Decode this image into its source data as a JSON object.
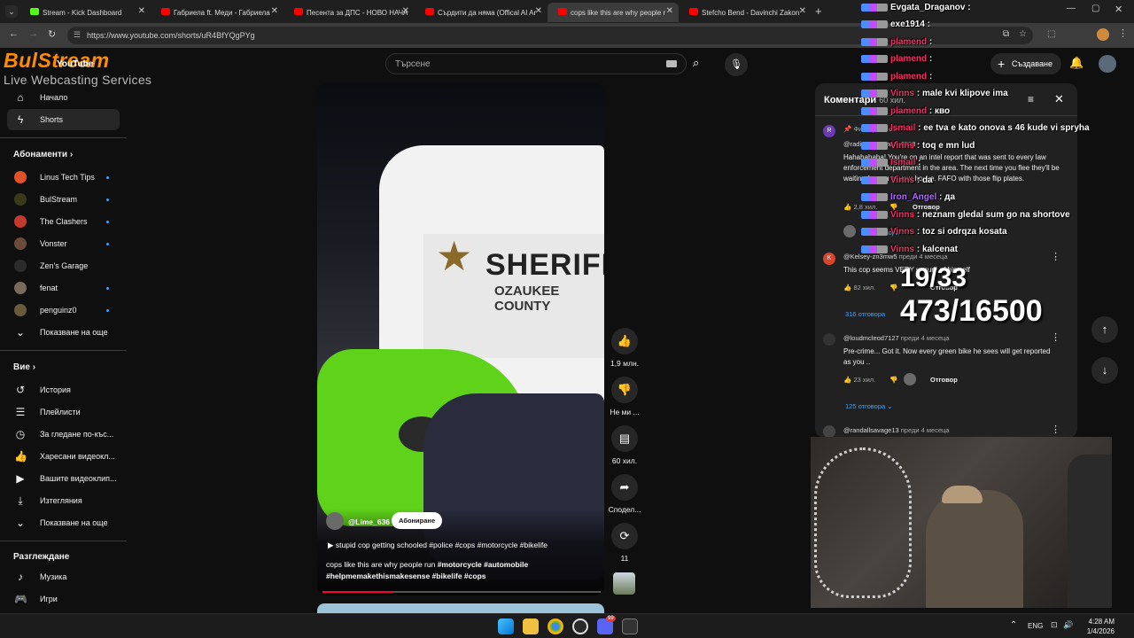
{
  "browser": {
    "tabs": [
      {
        "label": "Stream - Kick Dashboard",
        "favicon": "kick"
      },
      {
        "label": "Габриела ft. Меди - Габриела",
        "favicon": "youtube"
      },
      {
        "label": "Песента за ДПС - НОВО НАЧА",
        "favicon": "youtube"
      },
      {
        "label": "Сърдити да няма (Offical AI Ar",
        "favicon": "youtube"
      },
      {
        "label": "cops like this are why people r",
        "favicon": "youtube",
        "active": true
      },
      {
        "label": "Stefcho Bend - Davinchi Zakon",
        "favicon": "youtube"
      }
    ],
    "url": "https://www.youtube.com/shorts/uR4BfYQgPYg"
  },
  "overlay_logo": {
    "line1": "BulStream",
    "line2": "Live Webcasting Services",
    "yt_text": "YouTube"
  },
  "search": {
    "placeholder": "Търсене"
  },
  "header": {
    "create_label": "Създаване"
  },
  "sidebar": {
    "home": "Начало",
    "shorts": "Shorts",
    "subscriptions_title": "Абонаменти",
    "subscriptions": [
      {
        "label": "Linus Tech Tips",
        "color": "#e0512a"
      },
      {
        "label": "BulStream",
        "color": "#3a3a1a"
      },
      {
        "label": "The Clashers",
        "color": "#c43b2d"
      },
      {
        "label": "Vonster",
        "color": "#6b4a3a"
      },
      {
        "label": "Zen's Garage",
        "color": "#2b2b2b"
      },
      {
        "label": "fenat",
        "color": "#7a6a5a"
      },
      {
        "label": "penguinz0",
        "color": "#6a5a3a"
      }
    ],
    "show_more_1": "Показване на още",
    "you_title": "Вие",
    "you_items": [
      "История",
      "Плейлисти",
      "За гледане по-къс...",
      "Харесани видеокл...",
      "Вашите видеоклип...",
      "Изтегляния"
    ],
    "show_more_2": "Показване на още",
    "explore_title": "Разглеждане",
    "explore_items": [
      "Музика",
      "Игри"
    ]
  },
  "video": {
    "channel": "@Lime_636",
    "subscribe": "Абониране",
    "music_line": "stupid cop getting schooled #police #cops #motorcycle #bikelife",
    "title_line1_plain": "cops like this are why people run ",
    "title_line1_tags": "#motorcycle  #automobile",
    "title_line2": "#helpmemakethismakesense #bikelife  #cops",
    "sign_text": "SHERIFF",
    "county_text": "OZAUKEE COUNTY",
    "progress": 0.25
  },
  "actions": {
    "likes": "1,9 млн.",
    "dislike": "Не ми ...",
    "comments": "60 хил.",
    "share": "Сподел...",
    "remix": "11"
  },
  "comments_panel": {
    "title": "Коментари",
    "count": "60 хил.",
    "pinned_by": "Фиксирано от",
    "c1_user": "@radioreparemode8528",
    "c1_text": "Hahahahaha! You're on an intel report that was sent to every law enforcement department in the area. The next time you flee they'll be waiting for you at your house. FAFO with those flip plates.",
    "c1_likes": "2,8 хил.",
    "reply": "Отговор",
    "c1_replies": "23 отговора",
    "c2_user": "@Kelsey-zn3mw5",
    "c2_time": "преди 4 месеца",
    "c2_text": "This cop seems VERY unsure of himself",
    "c2_likes": "82 хил.",
    "c2_replies": "316 отговора",
    "c3_user": "@loudmcleod7127",
    "c3_time": "преди 4 месеца",
    "c3_text": "Pre-crime... Got it. Now every green bike he sees will get reported as you ..",
    "c3_likes": "23 хил.",
    "c3_replies": "125 отговора",
    "c4_user": "@randallsavage13",
    "c4_time": "преди 4 месеца"
  },
  "overlay_chat": [
    {
      "name": "Evgata_Draganov",
      "msg": "",
      "style": "white"
    },
    {
      "name": "exe1914",
      "msg": "",
      "style": "white"
    },
    {
      "name": "plamend",
      "msg": "",
      "style": "red"
    },
    {
      "name": "plamend",
      "msg": "",
      "style": "red"
    },
    {
      "name": "plamend",
      "msg": "",
      "style": "red"
    },
    {
      "name": "Vinns",
      "msg": "male kvi klipove ima",
      "style": "red"
    },
    {
      "name": "plamend",
      "msg": "кво",
      "style": "red"
    },
    {
      "name": "Ismail",
      "msg": "ee tva e kato onova s 46 kude vi spryha",
      "style": "red"
    },
    {
      "name": "Vinns",
      "msg": "toq e mn lud",
      "style": "red"
    },
    {
      "name": "Ismail",
      "msg": "",
      "style": "red"
    },
    {
      "name": "Vinns",
      "msg": "da",
      "style": "red"
    },
    {
      "name": "Iron_Angel",
      "msg": "да",
      "style": "purple"
    },
    {
      "name": "Vinns",
      "msg": "neznam gledal sum go na shortove",
      "style": "red"
    },
    {
      "name": "Vinns",
      "msg": "toz si odrqza kosata",
      "style": "red"
    },
    {
      "name": "Vinns",
      "msg": "kalcenat",
      "style": "red"
    }
  ],
  "overlay_counters": {
    "line1": "19/33",
    "line2": "473/16500"
  },
  "taskbar": {
    "lang": "ENG",
    "time": "4:28 AM",
    "date": "1/4/2026",
    "badge": "99"
  }
}
